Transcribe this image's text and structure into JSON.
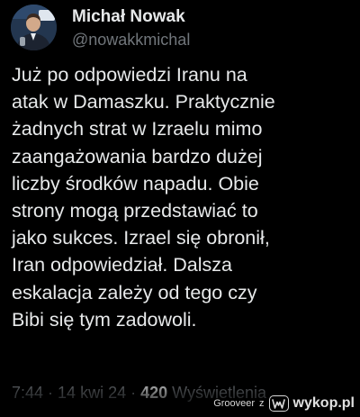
{
  "author": {
    "name": "Michał Nowak",
    "handle": "@nowakkmichal",
    "avatar_icon": "person-photo-icon"
  },
  "tweet": {
    "text": "Już po odpowiedzi Iranu na\natak w Damaszku. Praktycznie\nżadnych strat w Izraelu mimo\nzaangażowania bardzo dużej\nliczby środków napadu. Obie\nstrony mogą przedstawiać to\njako sukces. Izrael się obronił,\nIran odpowiedział. Dalsza\neskalacja zależy od tego czy\nBibi się tym zadowoli."
  },
  "meta": {
    "time": "7:44",
    "date": "14 kwi 24",
    "views_count": "420",
    "views_label": "Wyświetlenia",
    "separator": " · "
  },
  "watermark": {
    "author": "Grooveer",
    "z": "z",
    "site": "wykop.pl",
    "logo_icon": "wykop-logo-icon"
  },
  "colors": {
    "background": "#000000",
    "text": "#e7e9ea",
    "secondary": "#71767b"
  }
}
